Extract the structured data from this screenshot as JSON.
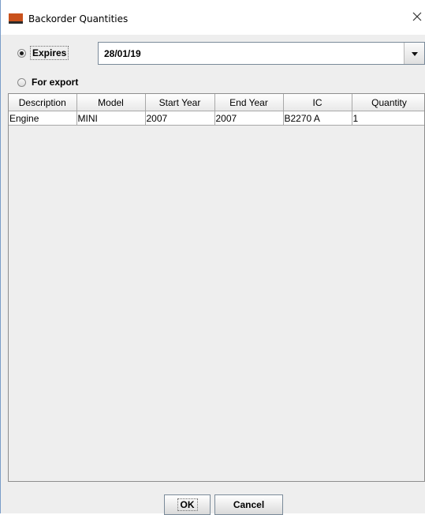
{
  "window": {
    "title": "Backorder Quantities",
    "accent_colors": {
      "icon_top": "#c9511c",
      "icon_bottom": "#2b2b2b",
      "border": "#7a9cc8"
    }
  },
  "options": {
    "expires": {
      "label": "Expires",
      "checked": true
    },
    "for_export": {
      "label": "For export",
      "checked": false
    }
  },
  "date_combo": {
    "value": "28/01/19"
  },
  "table": {
    "columns": [
      "Description",
      "Model",
      "Start Year",
      "End Year",
      "IC",
      "Quantity"
    ],
    "rows": [
      {
        "description": "Engine",
        "model": "MINI",
        "start_year": "2007",
        "end_year": "2007",
        "ic": "B2270 A",
        "quantity": "1"
      }
    ]
  },
  "buttons": {
    "ok_label": "OK",
    "cancel_label": "Cancel"
  },
  "icons": {
    "close": "close-icon",
    "dropdown": "chevron-down-icon",
    "app": "app-icon"
  }
}
